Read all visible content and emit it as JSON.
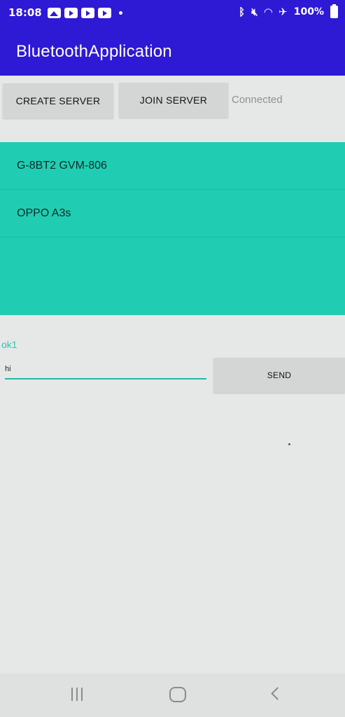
{
  "status_bar": {
    "time": "18:08",
    "battery": "100%",
    "notification_icons": [
      "gallery-icon",
      "youtube-icon",
      "youtube-icon",
      "youtube-icon"
    ],
    "system_icons": [
      "bluetooth-icon",
      "mute-icon",
      "wifi-icon",
      "airplane-icon"
    ]
  },
  "app_bar": {
    "title": "BluetoothApplication",
    "color": "#2e19d4"
  },
  "controls": {
    "create_server_label": "CREATE SERVER",
    "join_server_label": "JOIN SERVER",
    "connection_status": "Connected"
  },
  "device_list": {
    "background": "#20cdb2",
    "items": [
      {
        "name": "G-8BT2 GVM-806"
      },
      {
        "name": "OPPO A3s"
      }
    ]
  },
  "chat": {
    "received_message": "ok1",
    "input_value": "hi",
    "send_label": "SEND"
  },
  "nav_bar": {
    "icons": [
      "recent-apps-icon",
      "home-icon",
      "back-icon"
    ]
  }
}
